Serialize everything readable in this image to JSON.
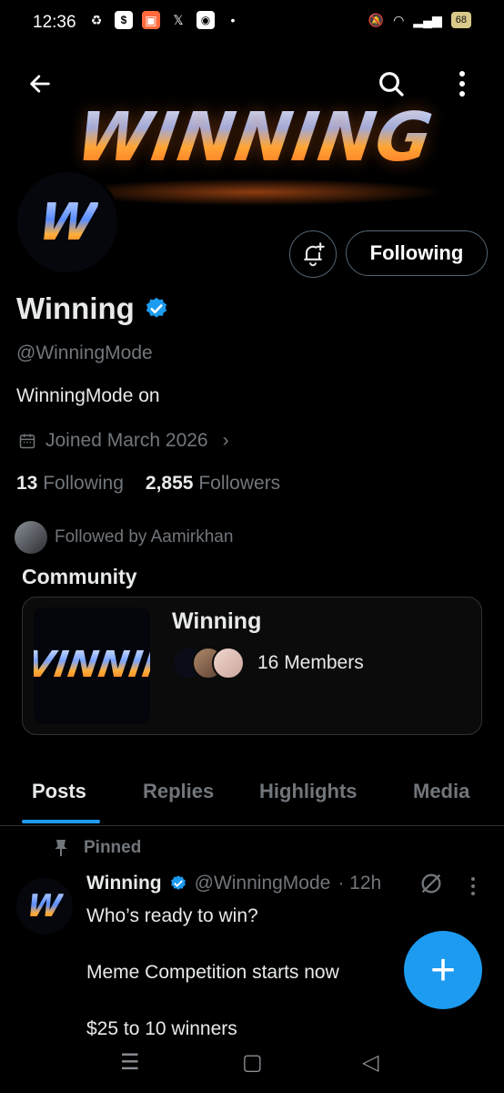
{
  "status_bar": {
    "time": "12:36",
    "battery": "68"
  },
  "profile": {
    "banner_text": "WINNING",
    "logo_letter": "W",
    "following_button": "Following",
    "name": "Winning",
    "handle": "@WinningMode",
    "bio": "WinningMode on",
    "joined": "Joined March 2026",
    "following_count": "13",
    "following_label": "Following",
    "followers_count": "2,855",
    "followers_label": "Followers",
    "followed_by": "Followed by Aamirkhan"
  },
  "community": {
    "title": "Community",
    "card_name": "Winning",
    "members": "16 Members",
    "image_text": "VINNIN"
  },
  "tabs": [
    {
      "label": "Posts"
    },
    {
      "label": "Replies"
    },
    {
      "label": "Highlights"
    },
    {
      "label": "Media"
    }
  ],
  "post": {
    "pinned_label": "Pinned",
    "author": "Winning",
    "handle": "@WinningMode",
    "time": "· 12h",
    "text": "Who’s ready to win?\n\nMeme Competition starts now\n\n$25 to 10 winners"
  },
  "colors": {
    "accent": "#1d9bf0",
    "muted": "#71767b",
    "background": "#000000"
  }
}
